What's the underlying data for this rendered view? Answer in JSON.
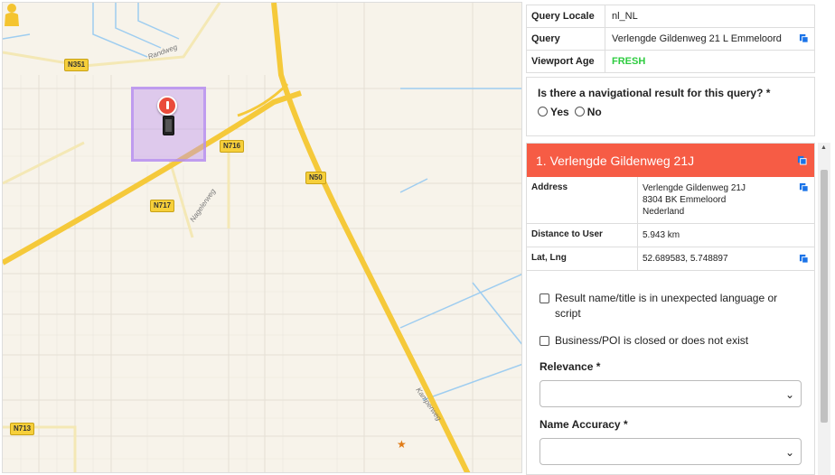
{
  "map": {
    "roads": [
      {
        "badge": "N351"
      },
      {
        "badge": "N716"
      },
      {
        "badge": "N717"
      },
      {
        "badge": "N50"
      },
      {
        "badge": "N713"
      }
    ],
    "streets": [
      "Randweg",
      "Nagelerweg",
      "Kamperweg"
    ]
  },
  "info": {
    "query_locale_label": "Query Locale",
    "query_locale_value": "nl_NL",
    "query_label": "Query",
    "query_value": "Verlengde Gildenweg 21 L Emmeloord",
    "viewport_label": "Viewport Age",
    "viewport_value": "FRESH"
  },
  "question": {
    "text": "Is there a navigational result for this query? *",
    "yes": "Yes",
    "no": "No"
  },
  "result": {
    "title": "1. Verlengde Gildenweg 21J",
    "address_label": "Address",
    "address_line1": "Verlengde Gildenweg 21J",
    "address_line2": "8304 BK Emmeloord",
    "address_line3": "Nederland",
    "distance_label": "Distance to User",
    "distance_value": "5.943 km",
    "latlng_label": "Lat, Lng",
    "latlng_value": "52.689583, 5.748897",
    "check1": "Result name/title is in unexpected language or script",
    "check2": "Business/POI is closed or does not exist",
    "relevance_label": "Relevance *",
    "name_accuracy_label": "Name Accuracy *"
  },
  "colors": {
    "header": "#f65c45",
    "fresh": "#2ecc40",
    "copy_icon": "#1a73e8"
  }
}
